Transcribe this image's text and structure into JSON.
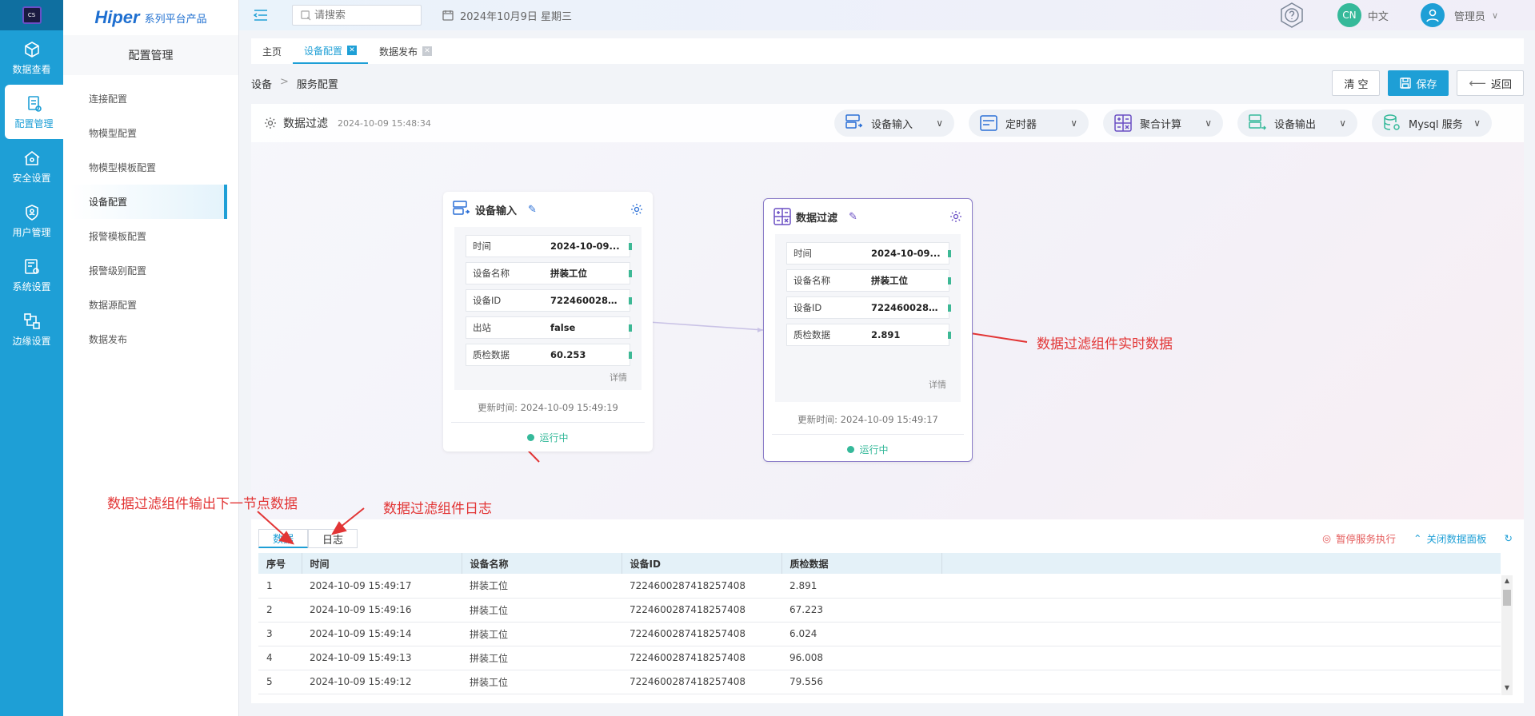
{
  "rail": {
    "logo_text": "CS",
    "items": [
      {
        "label": "数据查看",
        "icon": "cube-icon"
      },
      {
        "label": "配置管理",
        "icon": "config-icon"
      },
      {
        "label": "安全设置",
        "icon": "security-icon"
      },
      {
        "label": "用户管理",
        "icon": "user-shield-icon"
      },
      {
        "label": "系统设置",
        "icon": "system-icon"
      },
      {
        "label": "边缘设置",
        "icon": "edge-icon"
      }
    ]
  },
  "brand": {
    "name": "Hiper",
    "suffix": "系列平台产品"
  },
  "menu": {
    "title": "配置管理",
    "items": [
      "连接配置",
      "物模型配置",
      "物模型模板配置",
      "设备配置",
      "报警模板配置",
      "报警级别配置",
      "数据源配置",
      "数据发布"
    ]
  },
  "topbar": {
    "search_placeholder": "请搜索",
    "date": "2024年10月9日 星期三",
    "lang_badge": "CN",
    "lang": "中文",
    "user": "管理员"
  },
  "tabs": [
    {
      "label": "主页",
      "closable": false
    },
    {
      "label": "设备配置",
      "closable": true
    },
    {
      "label": "数据发布",
      "closable": true
    }
  ],
  "breadcrumb": {
    "root": "设备",
    "sep": ">",
    "current": "服务配置"
  },
  "actions": {
    "clear": "清 空",
    "save": "保存",
    "back": "返回"
  },
  "canvas": {
    "title": "数据过滤",
    "time": "2024-10-09 15:48:34",
    "tools": [
      "设备输入",
      "定时器",
      "聚合计算",
      "设备输出",
      "Mysql 服务"
    ]
  },
  "node_input": {
    "title": "设备输入",
    "fields": [
      {
        "k": "时间",
        "v": "2024-10-09..."
      },
      {
        "k": "设备名称",
        "v": "拼装工位"
      },
      {
        "k": "设备ID",
        "v": "7224600287..."
      },
      {
        "k": "出站",
        "v": "false"
      },
      {
        "k": "质检数据",
        "v": "60.253"
      }
    ],
    "detail": "详情",
    "updated": "更新时间: 2024-10-09 15:49:19",
    "status": "运行中"
  },
  "node_filter": {
    "title": "数据过滤",
    "fields": [
      {
        "k": "时间",
        "v": "2024-10-09..."
      },
      {
        "k": "设备名称",
        "v": "拼装工位"
      },
      {
        "k": "设备ID",
        "v": "7224600287..."
      },
      {
        "k": "质检数据",
        "v": "2.891"
      }
    ],
    "detail": "详情",
    "updated": "更新时间: 2024-10-09 15:49:17",
    "status": "运行中"
  },
  "annotations": {
    "a1": "数据过滤组件实时数据",
    "a2": "数据过滤组件输出下一节点数据",
    "a3": "数据过滤组件日志"
  },
  "panel": {
    "tab_data": "数据",
    "tab_log": "日志",
    "pause": "暂停服务执行",
    "close": "关闭数据面板",
    "headers": [
      "序号",
      "时间",
      "设备名称",
      "设备ID",
      "质检数据"
    ],
    "rows": [
      [
        "1",
        "2024-10-09 15:49:17",
        "拼装工位",
        "7224600287418257408",
        "2.891"
      ],
      [
        "2",
        "2024-10-09 15:49:16",
        "拼装工位",
        "7224600287418257408",
        "67.223"
      ],
      [
        "3",
        "2024-10-09 15:49:14",
        "拼装工位",
        "7224600287418257408",
        "6.024"
      ],
      [
        "4",
        "2024-10-09 15:49:13",
        "拼装工位",
        "7224600287418257408",
        "96.008"
      ],
      [
        "5",
        "2024-10-09 15:49:12",
        "拼装工位",
        "7224600287418257408",
        "79.556"
      ]
    ]
  },
  "colors": {
    "primary": "#1e9fd6",
    "accent": "#35b99a",
    "annotation": "#e23535"
  }
}
